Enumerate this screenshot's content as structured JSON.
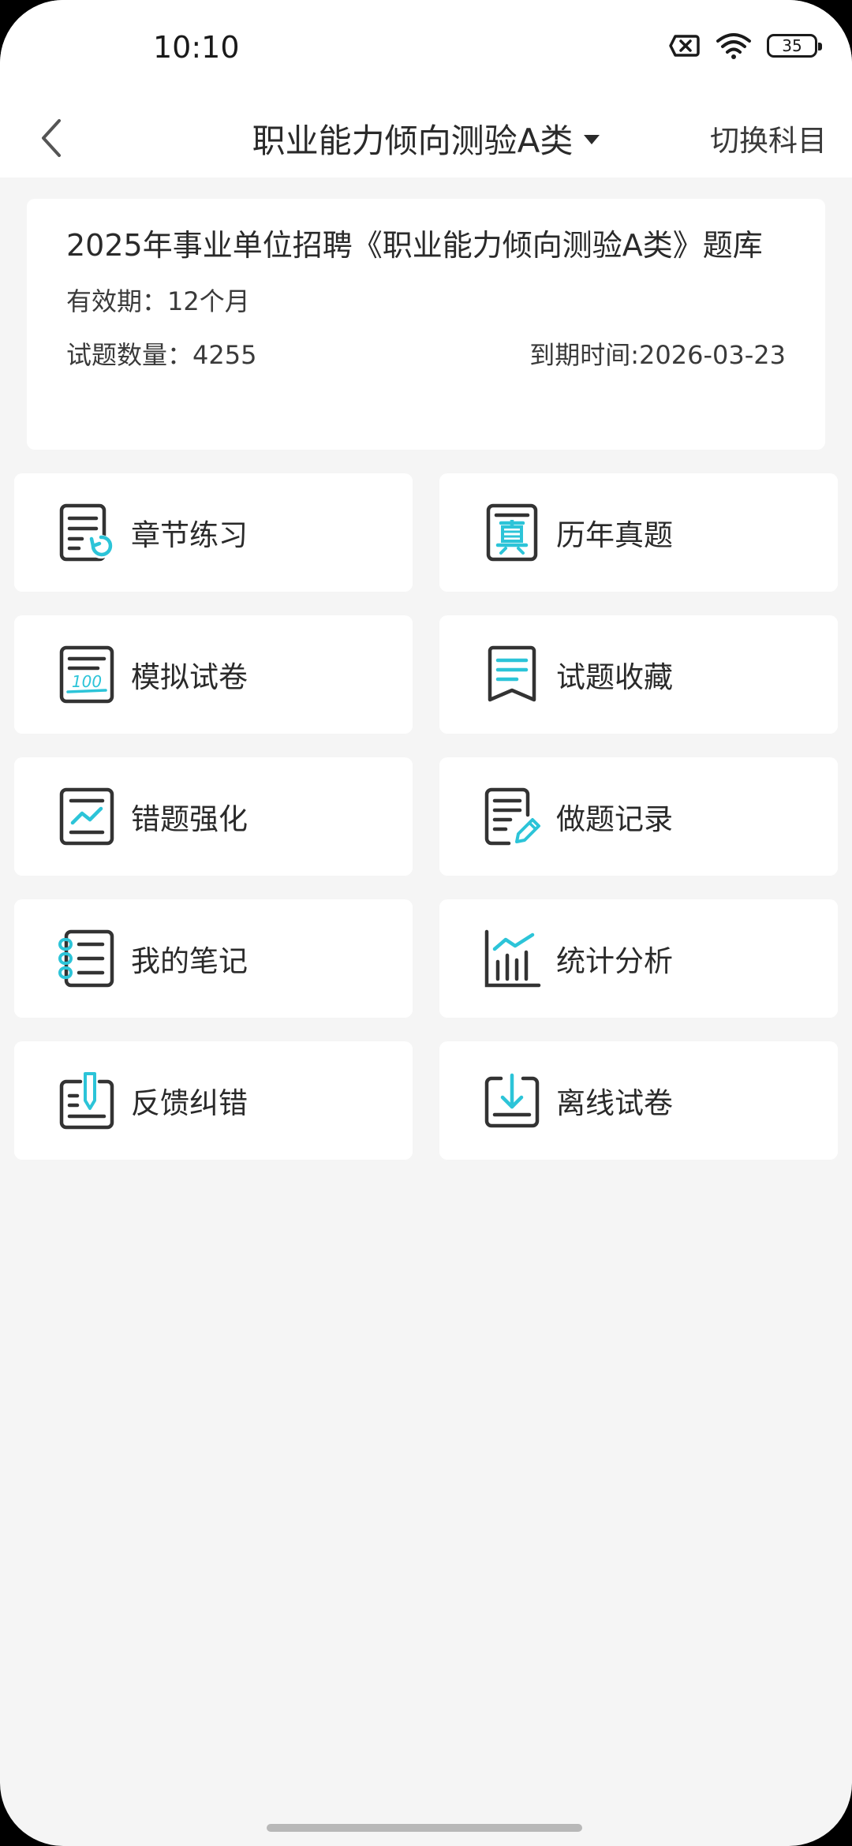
{
  "status_bar": {
    "time": "10:10",
    "battery_level": "35"
  },
  "header": {
    "title": "职业能力倾向测验A类",
    "switch_label": "切换科目"
  },
  "info_card": {
    "title": "2025年事业单位招聘《职业能力倾向测验A类》题库",
    "validity": "有效期：12个月",
    "question_count": "试题数量：4255",
    "expiry": "到期时间:2026-03-23"
  },
  "menu": {
    "items": [
      {
        "label": "章节练习",
        "icon": "chapter-practice-icon"
      },
      {
        "label": "历年真题",
        "icon": "past-exams-icon"
      },
      {
        "label": "模拟试卷",
        "icon": "mock-exam-icon"
      },
      {
        "label": "试题收藏",
        "icon": "favorites-icon"
      },
      {
        "label": "错题强化",
        "icon": "wrong-questions-icon"
      },
      {
        "label": "做题记录",
        "icon": "practice-record-icon"
      },
      {
        "label": "我的笔记",
        "icon": "notes-icon"
      },
      {
        "label": "统计分析",
        "icon": "statistics-icon"
      },
      {
        "label": "反馈纠错",
        "icon": "feedback-icon"
      },
      {
        "label": "离线试卷",
        "icon": "offline-download-icon"
      }
    ]
  },
  "colors": {
    "accent": "#2cc4d8",
    "icon_dark": "#333333",
    "background": "#f5f5f5",
    "card": "#ffffff"
  }
}
